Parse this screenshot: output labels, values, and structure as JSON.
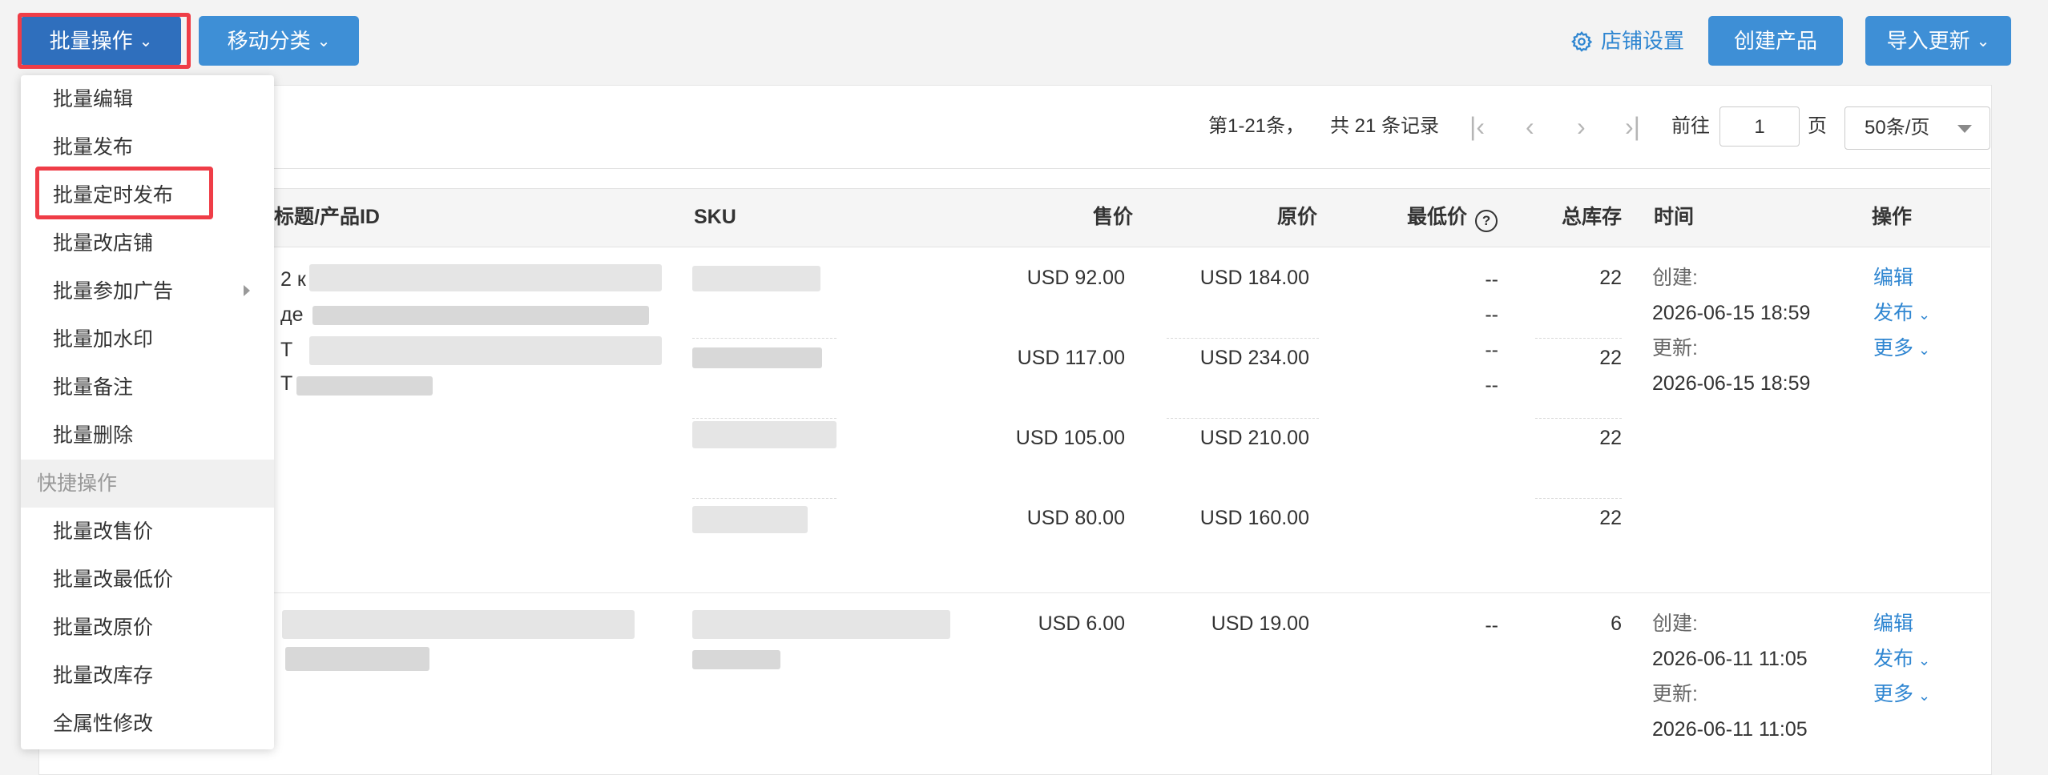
{
  "toolbar": {
    "batch_ops": "批量操作",
    "move_category": "移动分类",
    "store_settings": "店铺设置",
    "create_product": "创建产品",
    "import_update": "导入更新"
  },
  "pager": {
    "range": "第1-21条，",
    "total": "共 21 条记录",
    "goto": "前往",
    "page": "1",
    "page_unit": "页",
    "page_size": "50条/页"
  },
  "table": {
    "headers": {
      "title": "标题/产品ID",
      "sku": "SKU",
      "price": "售价",
      "original": "原价",
      "min_price": "最低价",
      "stock": "总库存",
      "time": "时间",
      "actions": "操作"
    },
    "rows": [
      {
        "title_fragments": [
          "2 к",
          "де",
          "Т",
          "Т"
        ],
        "variants": [
          {
            "price": "USD 92.00",
            "original": "USD 184.00",
            "min1": "--",
            "min2": "--",
            "stock": "22"
          },
          {
            "price": "USD 117.00",
            "original": "USD 234.00",
            "min1": "--",
            "min2": "--",
            "stock": "22"
          },
          {
            "price": "USD 105.00",
            "original": "USD 210.00",
            "stock": "22"
          },
          {
            "price": "USD 80.00",
            "original": "USD 160.00",
            "stock": "22"
          }
        ],
        "created_label": "创建:",
        "created": "2026-06-15 18:59",
        "updated_label": "更新:",
        "updated": "2026-06-15 18:59",
        "edit": "编辑",
        "publish": "发布",
        "more": "更多"
      },
      {
        "variants": [
          {
            "price": "USD 6.00",
            "original": "USD 19.00",
            "min1": "--",
            "stock": "6"
          }
        ],
        "created_label": "创建:",
        "created": "2026-06-11 11:05",
        "updated_label": "更新:",
        "updated": "2026-06-11 11:05",
        "edit": "编辑",
        "publish": "发布",
        "more": "更多"
      }
    ]
  },
  "dropdown": {
    "items": [
      "批量编辑",
      "批量发布",
      "批量定时发布",
      "批量改店铺",
      "批量参加广告",
      "批量加水印",
      "批量备注",
      "批量删除"
    ],
    "group_label": "快捷操作",
    "quick_items": [
      "批量改售价",
      "批量改最低价",
      "批量改原价",
      "批量改库存",
      "全属性修改"
    ]
  },
  "colors": {
    "primary": "#3e8fd6",
    "primary_dark": "#2f6fbd",
    "link": "#2f86d1",
    "highlight": "#ef3d47"
  }
}
